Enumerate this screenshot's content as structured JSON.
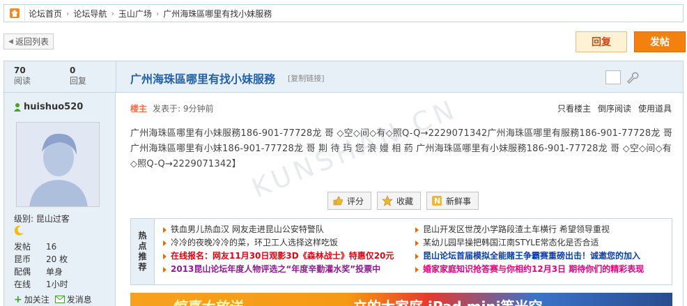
{
  "breadcrumb": [
    "论坛首页",
    "论坛导航",
    "玉山广场",
    "广州海珠區哪里有找小妹服務"
  ],
  "toolbar": {
    "back": "返回列表",
    "reply": "回复",
    "post": "发帖"
  },
  "stats": {
    "views": "70",
    "views_label": "阅读",
    "replies": "0",
    "replies_label": "回复"
  },
  "thread": {
    "title": "广州海珠區哪里有找小妹服務",
    "copy_link": "[复制链接]"
  },
  "author": {
    "name": "huishuo520",
    "level": "级别: 昆山过客",
    "info": [
      {
        "k": "发帖",
        "v": "16"
      },
      {
        "k": "昆币",
        "v": "20 枚"
      },
      {
        "k": "配偶",
        "v": "单身"
      },
      {
        "k": "在线",
        "v": "1小时"
      }
    ],
    "follow": "加关注",
    "message": "发消息"
  },
  "post": {
    "floor": "楼主",
    "posted": "发表于: 9分钟前",
    "links": [
      "只看楼主",
      "倒序阅读",
      "使用道具"
    ],
    "content": "广州海珠區哪里有小妹服務186-901-77728龙 哥 ◇空◇间◇有◇照Q-Q→2229071342广州海珠區哪里有服務186-901-77728龙 哥广州海珠區哪里有小妹186-901-77728龙 哥 剘 待 玙 您 浪 嫚 相 葯 广州海珠區哪里有小妹服務186-901-77728龙 哥 ◇空◇间◇有◇照Q-Q→2229071342】",
    "watermark": "KUNSHAN.CN"
  },
  "actions": [
    "评分",
    "收藏",
    "新鲜事"
  ],
  "hot": {
    "label": [
      "热",
      "点",
      "推",
      "荐"
    ],
    "left": [
      {
        "text": "铁血男儿热血汉 网友走进昆山公安特警队",
        "color": "#333333",
        "bold": false
      },
      {
        "text": "冷冷的夜晚冷冷的菜，环卫工人选择这样吃饭",
        "color": "#333333",
        "bold": false
      },
      {
        "text": "在线报名：网友11月30日观影3D《森林战士》特惠仅20元",
        "color": "#e60012",
        "bold": true
      },
      {
        "text": "2013昆山论坛年度人物评选之“年度辛勤灌水奖”投票中",
        "color": "#8b1c8f",
        "bold": true
      }
    ],
    "right": [
      {
        "text": "昆山开发区世茂小学路段渣土车横行 希望领导重视",
        "color": "#333333",
        "bold": false
      },
      {
        "text": "某幼儿园早操把韩国江南STYLE常态化是否合适",
        "color": "#333333",
        "bold": false
      },
      {
        "text": "昆山论坛首届模拟全能赌王争霸赛重磅出击！诚邀您的加入",
        "color": "#0a3fa8",
        "bold": true
      },
      {
        "text": "婚家家庭知识抢答赛与你相约12月3日 期待你们的精彩表现",
        "color": "#e4007f",
        "bold": true
      }
    ]
  },
  "banner": {
    "text": "立的大家庭 iPad mini等米空",
    "text2": "惊喜大放送"
  }
}
